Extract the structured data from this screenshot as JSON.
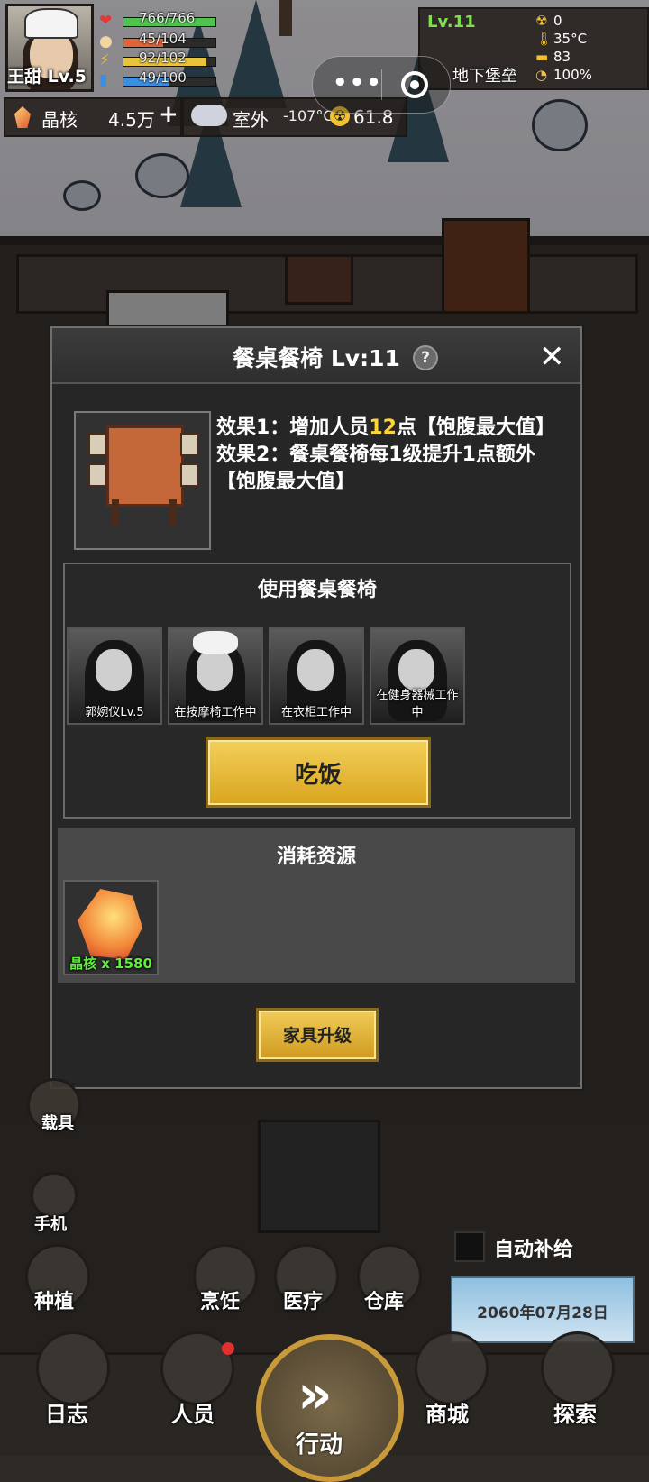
{
  "player": {
    "name": "王甜 Lv.5"
  },
  "stats": [
    {
      "icon": "heart-icon",
      "value": "766/766",
      "fraction": 1.0,
      "color": "#4fc24f"
    },
    {
      "icon": "food-icon",
      "value": "45/104",
      "fraction": 0.43,
      "color": "#e0643a"
    },
    {
      "icon": "energy-icon",
      "value": "92/102",
      "fraction": 0.9,
      "color": "#e8c43a"
    },
    {
      "icon": "water-icon",
      "value": "49/100",
      "fraction": 0.49,
      "color": "#3a8fe0"
    }
  ],
  "resources": {
    "crystal_label": "晶核",
    "crystal_value": "4.5万",
    "plus": "+"
  },
  "weather": {
    "outside_label": "室外",
    "temperature": "-107°C",
    "radiation": "61.8"
  },
  "base": {
    "level": "Lv.11",
    "name": "地下堡垒",
    "radiation": "0",
    "temperature": "35°C",
    "supplies": "83",
    "power": "100%"
  },
  "dialog": {
    "title": "餐桌餐椅 Lv:11",
    "help": "?",
    "close": "✕",
    "effect_prefix": "效果1：增加人员",
    "effect_highlight": "12",
    "effect_suffix": "点【饱腹最大值】 效果2：餐桌餐椅每1级提升1点额外【饱腹最大值】",
    "use_title": "使用餐桌餐椅",
    "characters": [
      {
        "label": "郭婉仪Lv.5"
      },
      {
        "label": "在按摩椅工作中"
      },
      {
        "label": "在衣柜工作中"
      },
      {
        "label": "在健身器械工作中"
      }
    ],
    "eat_button": "吃饭",
    "cost_title": "消耗资源",
    "cost_item": "晶核 x 1580",
    "upgrade_button": "家具升级"
  },
  "side": {
    "vehicle": "载具",
    "phone": "手机",
    "plant": "种植",
    "cook": "烹饪",
    "medical": "医疗",
    "storage": "仓库"
  },
  "auto_supply": "自动补给",
  "date": "2060年07月28日",
  "nav": {
    "log": "日志",
    "people": "人员",
    "action": "行动",
    "shop": "商城",
    "explore": "探索"
  },
  "colors": {
    "accent_gold": "#f2c230",
    "highlight": "#ffd23a",
    "cost_green": "#5ef03a"
  }
}
